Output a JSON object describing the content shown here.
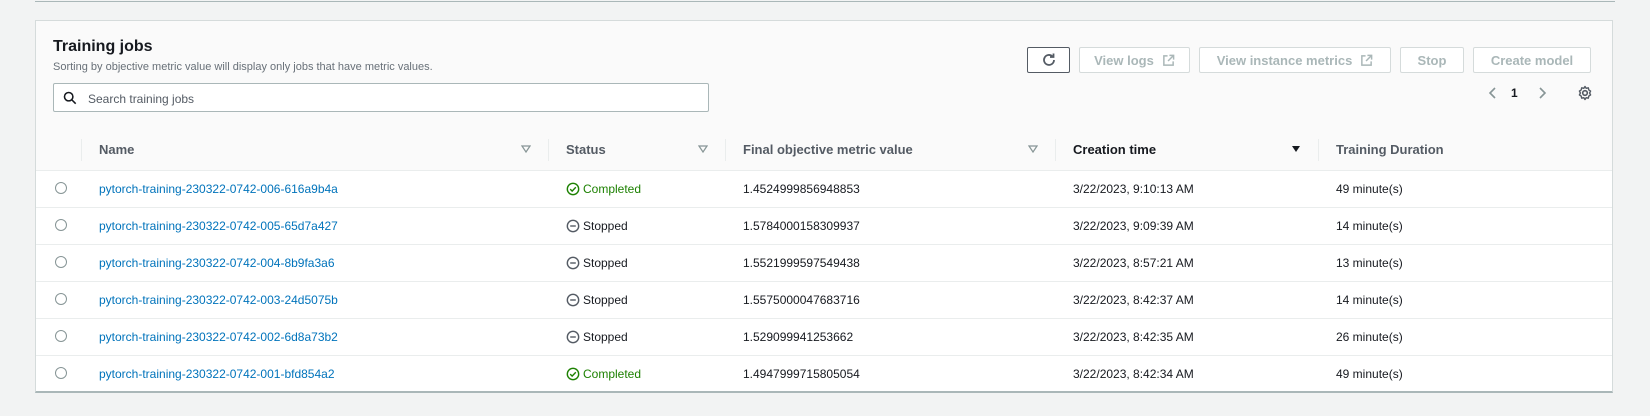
{
  "panel": {
    "title": "Training jobs",
    "description": "Sorting by objective metric value will display only jobs that have metric values.",
    "search_placeholder": "Search training jobs"
  },
  "toolbar": {
    "refresh_icon": "refresh-icon",
    "view_logs": "View logs",
    "view_instance_metrics": "View instance metrics",
    "stop": "Stop",
    "create_model": "Create model"
  },
  "pagination": {
    "current_page": "1"
  },
  "columns": {
    "name": "Name",
    "status": "Status",
    "metric": "Final objective metric value",
    "creation_time": "Creation time",
    "duration": "Training Duration"
  },
  "rows": [
    {
      "name": "pytorch-training-230322-0742-006-616a9b4a",
      "status": "Completed",
      "status_type": "completed",
      "metric": "1.4524999856948853",
      "creation_time": "3/22/2023, 9:10:13 AM",
      "duration": "49 minute(s)"
    },
    {
      "name": "pytorch-training-230322-0742-005-65d7a427",
      "status": "Stopped",
      "status_type": "stopped",
      "metric": "1.5784000158309937",
      "creation_time": "3/22/2023, 9:09:39 AM",
      "duration": "14 minute(s)"
    },
    {
      "name": "pytorch-training-230322-0742-004-8b9fa3a6",
      "status": "Stopped",
      "status_type": "stopped",
      "metric": "1.5521999597549438",
      "creation_time": "3/22/2023, 8:57:21 AM",
      "duration": "13 minute(s)"
    },
    {
      "name": "pytorch-training-230322-0742-003-24d5075b",
      "status": "Stopped",
      "status_type": "stopped",
      "metric": "1.5575000047683716",
      "creation_time": "3/22/2023, 8:42:37 AM",
      "duration": "14 minute(s)"
    },
    {
      "name": "pytorch-training-230322-0742-002-6d8a73b2",
      "status": "Stopped",
      "status_type": "stopped",
      "metric": "1.529099941253662",
      "creation_time": "3/22/2023, 8:42:35 AM",
      "duration": "26 minute(s)"
    },
    {
      "name": "pytorch-training-230322-0742-001-bfd854a2",
      "status": "Completed",
      "status_type": "completed",
      "metric": "1.4947999715805054",
      "creation_time": "3/22/2023, 8:42:34 AM",
      "duration": "49 minute(s)"
    }
  ],
  "colors": {
    "link": "#0073bb",
    "completed": "#1d8102",
    "disabled_text": "#aab7b8"
  }
}
